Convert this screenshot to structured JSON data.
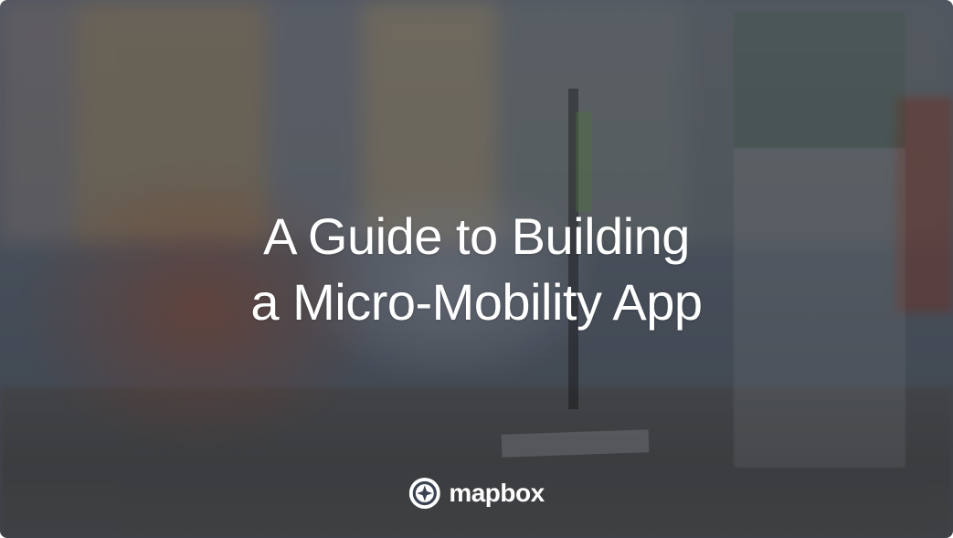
{
  "hero": {
    "title_line1": "A Guide to Building",
    "title_line2": "a Micro-Mobility App"
  },
  "brand": {
    "name": "mapbox"
  }
}
